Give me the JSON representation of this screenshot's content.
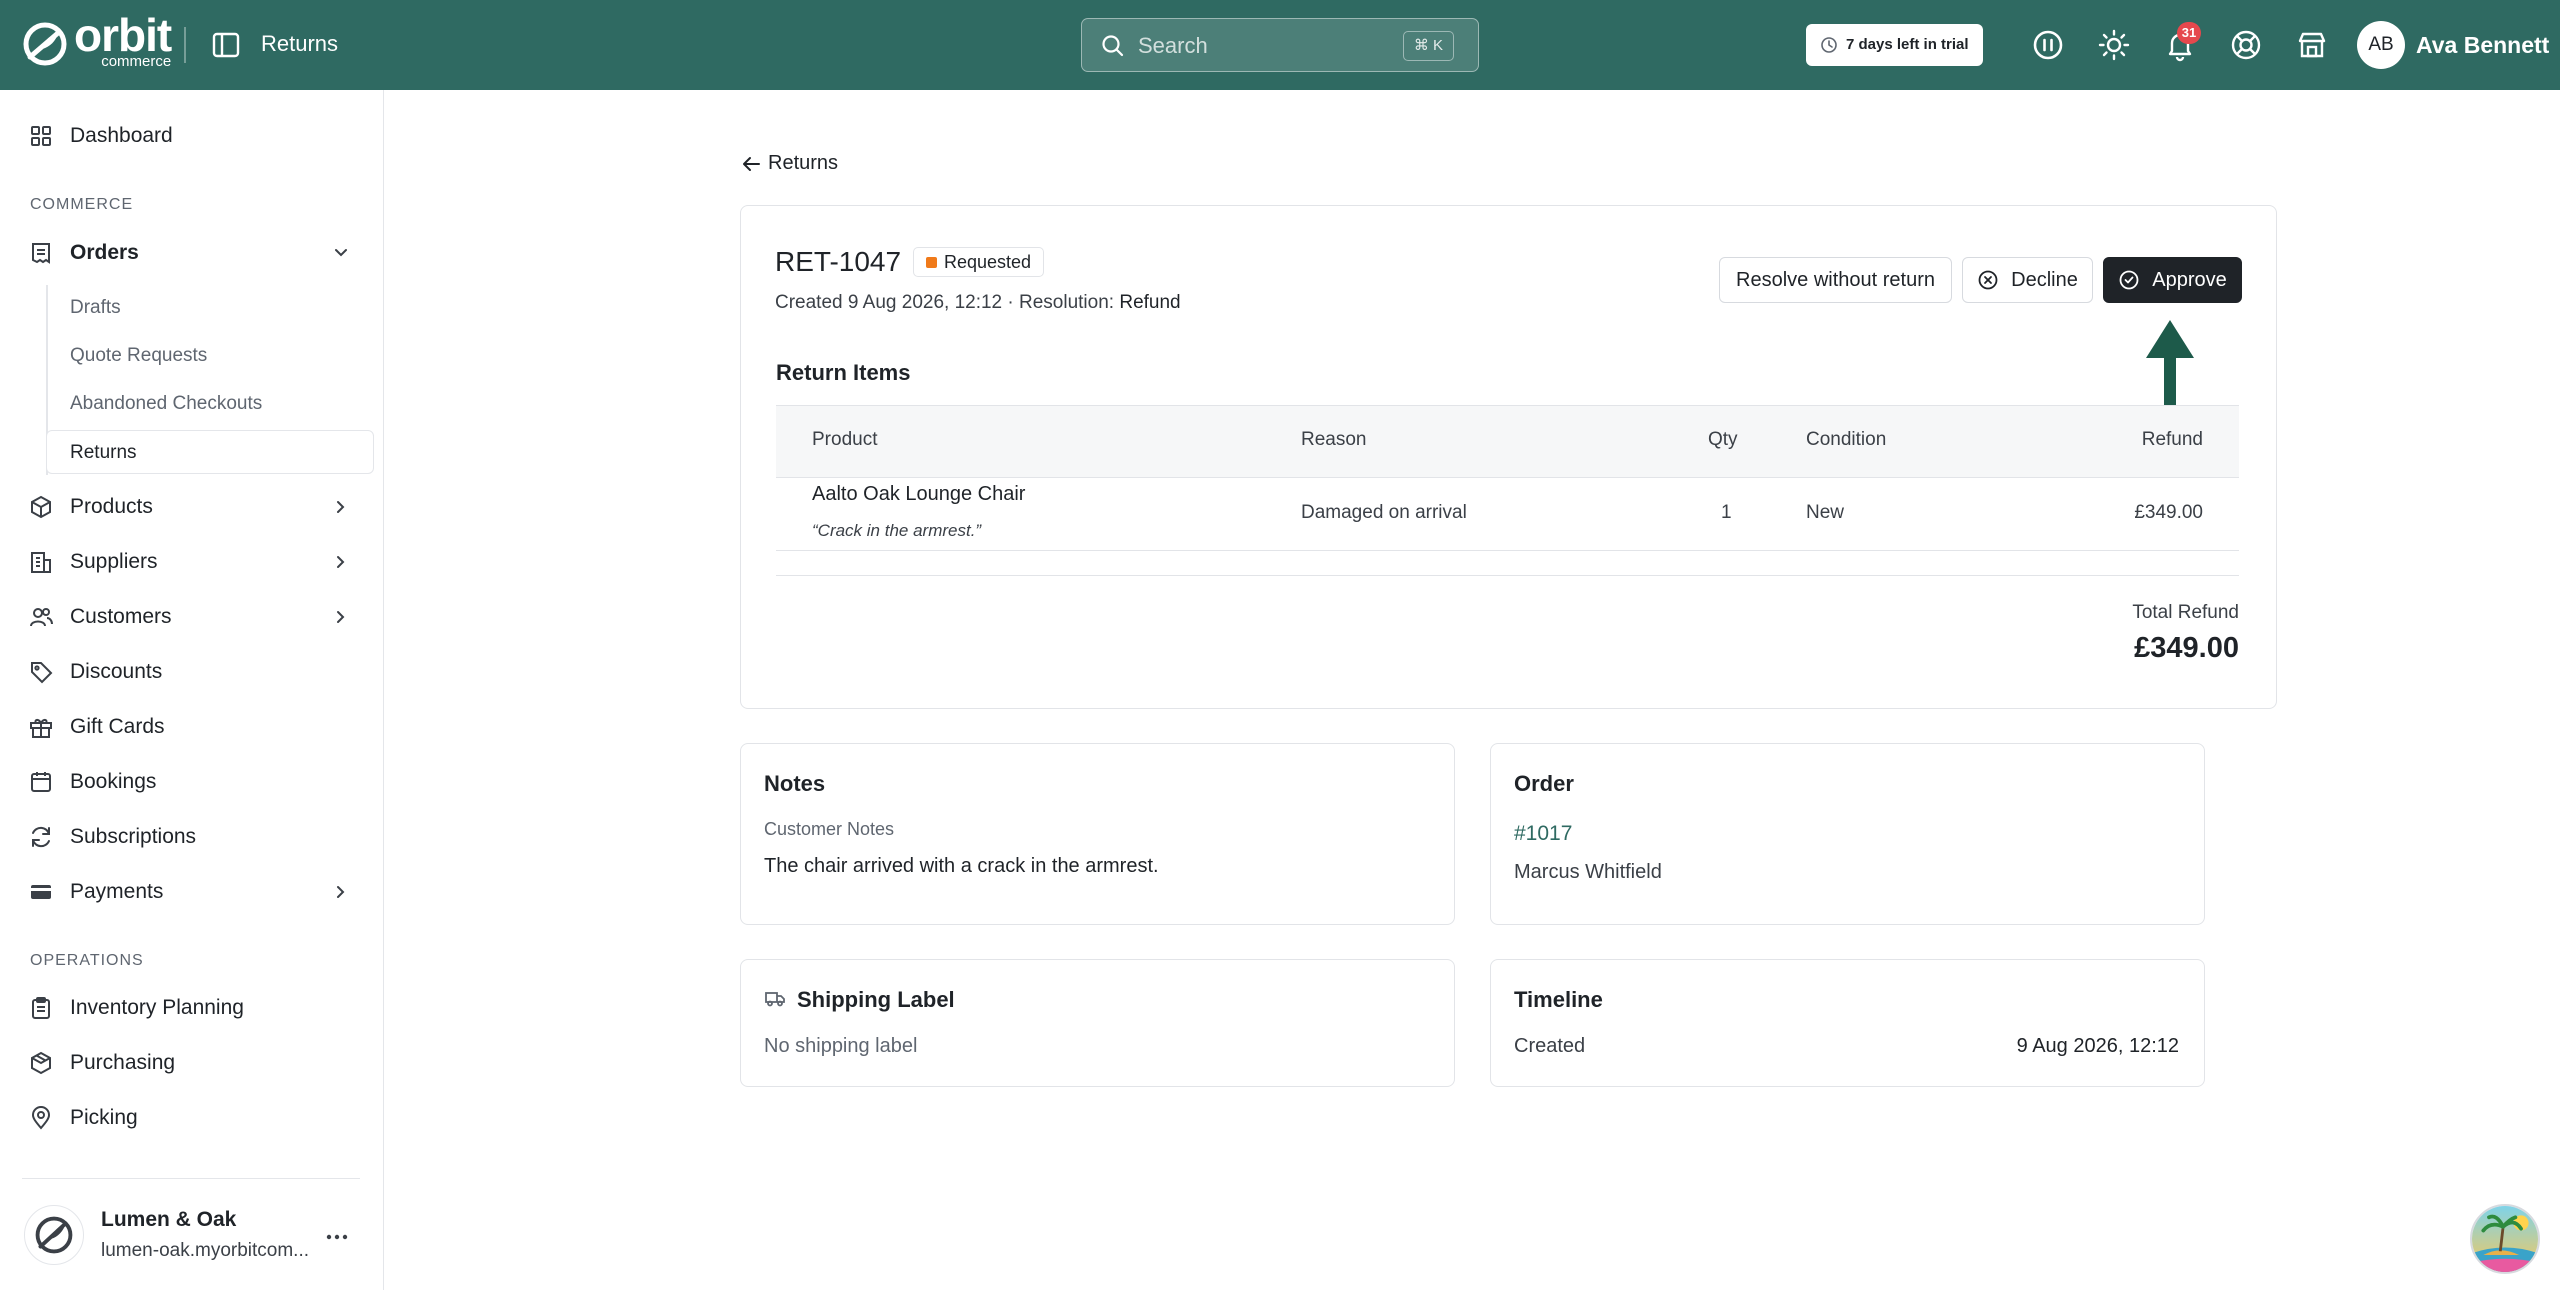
{
  "app": {
    "brand": "orbit",
    "brand_sub": "commerce",
    "page_title": "Returns"
  },
  "topbar": {
    "search_placeholder": "Search",
    "search_shortcut": "⌘ K",
    "trial_text": "7 days left in trial",
    "notification_count": "31",
    "user_initials": "AB",
    "user_name": "Ava Bennett"
  },
  "sidebar": {
    "dashboard": "Dashboard",
    "section_commerce": "COMMERCE",
    "orders": "Orders",
    "orders_sub": [
      "Drafts",
      "Quote Requests",
      "Abandoned Checkouts",
      "Returns"
    ],
    "products": "Products",
    "suppliers": "Suppliers",
    "customers": "Customers",
    "discounts": "Discounts",
    "gift_cards": "Gift Cards",
    "bookings": "Bookings",
    "subscriptions": "Subscriptions",
    "payments": "Payments",
    "section_operations": "OPERATIONS",
    "inventory_planning": "Inventory Planning",
    "purchasing": "Purchasing",
    "picking": "Picking",
    "store_name": "Lumen & Oak",
    "store_url": "lumen-oak.myorbitcom..."
  },
  "main": {
    "back_label": "Returns",
    "return_id": "RET-1047",
    "status": "Requested",
    "created_prefix": "Created 9 Aug 2026, 12:12 · Resolution:",
    "resolution": "Refund",
    "actions": {
      "resolve": "Resolve without return",
      "decline": "Decline",
      "approve": "Approve"
    },
    "items_title": "Return Items",
    "columns": [
      "Product",
      "Reason",
      "Qty",
      "Condition",
      "Refund"
    ],
    "items": [
      {
        "product": "Aalto Oak Lounge Chair",
        "note": "“Crack in the armrest.”",
        "reason": "Damaged on arrival",
        "qty": "1",
        "condition": "New",
        "refund": "£349.00"
      }
    ],
    "total_label": "Total Refund",
    "total_value": "£349.00",
    "notes": {
      "title": "Notes",
      "label": "Customer Notes",
      "text": "The chair arrived with a crack in the armrest."
    },
    "order": {
      "title": "Order",
      "number": "#1017",
      "customer": "Marcus Whitfield"
    },
    "shipping": {
      "title": "Shipping Label",
      "text": "No shipping label"
    },
    "timeline": {
      "title": "Timeline",
      "event": "Created",
      "date": "9 Aug 2026, 12:12"
    }
  },
  "colors": {
    "brand": "#2f6a62",
    "status_requested": "#f07a1a",
    "badge": "#e5484d"
  }
}
